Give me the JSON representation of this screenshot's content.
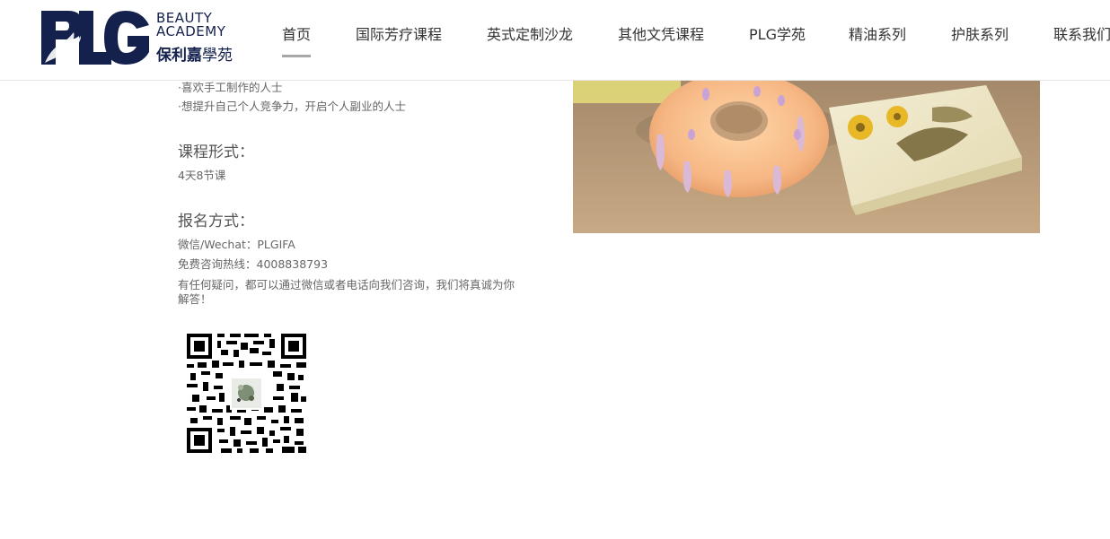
{
  "header": {
    "logo": {
      "mark_text": "PLG",
      "en_line1": "BEAUTY",
      "en_line2": "ACADEMY",
      "cn_bold": "保利嘉",
      "cn_rest": "學苑"
    },
    "nav": [
      {
        "label": "首页",
        "active": true
      },
      {
        "label": "国际芳疗课程",
        "active": false
      },
      {
        "label": "英式定制沙龙",
        "active": false
      },
      {
        "label": "其他文凭课程",
        "active": false
      },
      {
        "label": "PLG学苑",
        "active": false
      },
      {
        "label": "精油系列",
        "active": false
      },
      {
        "label": "护肤系列",
        "active": false
      },
      {
        "label": "联系我们",
        "active": false
      }
    ]
  },
  "main": {
    "audience": [
      "·喜欢手工制作的人士",
      "·想提升自己个人竞争力，开启个人副业的人士"
    ],
    "format_heading": "课程形式：",
    "format_value": "4天8节课",
    "signup_heading": "报名方式：",
    "wechat": "微信/Wechat：PLGIFA",
    "hotline": "免费咨询热线：4008838793",
    "note": "有任何疑问，都可以通过微信或者电话向我们咨询，我们将真诚为你解答！"
  },
  "colors": {
    "brand_navy": "#14214d",
    "nav_text": "#333333",
    "body_text": "#666666",
    "active_underline": "#a7a7a7"
  }
}
